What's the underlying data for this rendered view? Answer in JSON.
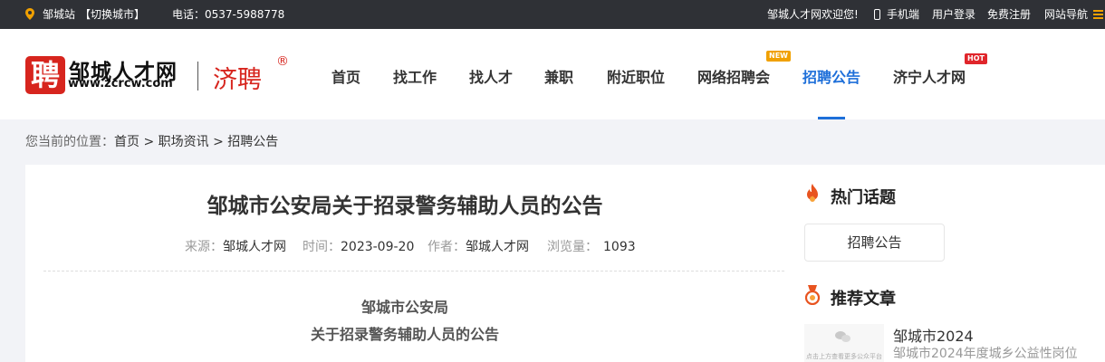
{
  "topbar": {
    "site_label": "邹城站",
    "switch_city": "【切换城市】",
    "phone": "电话：0537-5988778",
    "welcome": "邹城人才网欢迎您!",
    "mobile": "手机端",
    "login": "用户登录",
    "register": "免费注册",
    "site_nav": "网站导航"
  },
  "logo": {
    "seal_char": "聘",
    "name": "邹城人才网",
    "url": "www.zcrcw.com",
    "partner": "济聘",
    "registered_mark": "®"
  },
  "nav": {
    "items": [
      "首页",
      "找工作",
      "找人才",
      "兼职",
      "附近职位",
      "网络招聘会",
      "招聘公告",
      "济宁人才网"
    ],
    "active_index": 6,
    "badge_new": "NEW",
    "badge_hot": "HOT"
  },
  "breadcrumb": {
    "prefix": "您当前的位置：",
    "home": "首页",
    "sep1": " > ",
    "section": "职场资讯",
    "sep2": " > ",
    "current": "招聘公告"
  },
  "article": {
    "title": "邹城市公安局关于招录警务辅助人员的公告",
    "source_label": "来源：",
    "source": "邹城人才网",
    "time_label": "时间：",
    "time": "2023-09-20",
    "author_label": "作者：",
    "author": "邹城人才网",
    "views_label": "浏览量：",
    "views": "1093",
    "body_line1": "邹城市公安局",
    "body_line2": "关于招录警务辅助人员的公告"
  },
  "sidebar": {
    "hot_title": "热门话题",
    "hot_tag": "招聘公告",
    "rec_title": "推荐文章",
    "rec_item_title": "邹城市2024",
    "rec_item_desc": "邹城市2024年度城乡公益性岗位",
    "thumb_caption": "点击上方查看更多公众平台"
  },
  "colors": {
    "topbar_bg": "#2f3136",
    "brand_red": "#d7251e",
    "accent_blue": "#1e6fd9",
    "accent_orange": "#f0a000"
  }
}
